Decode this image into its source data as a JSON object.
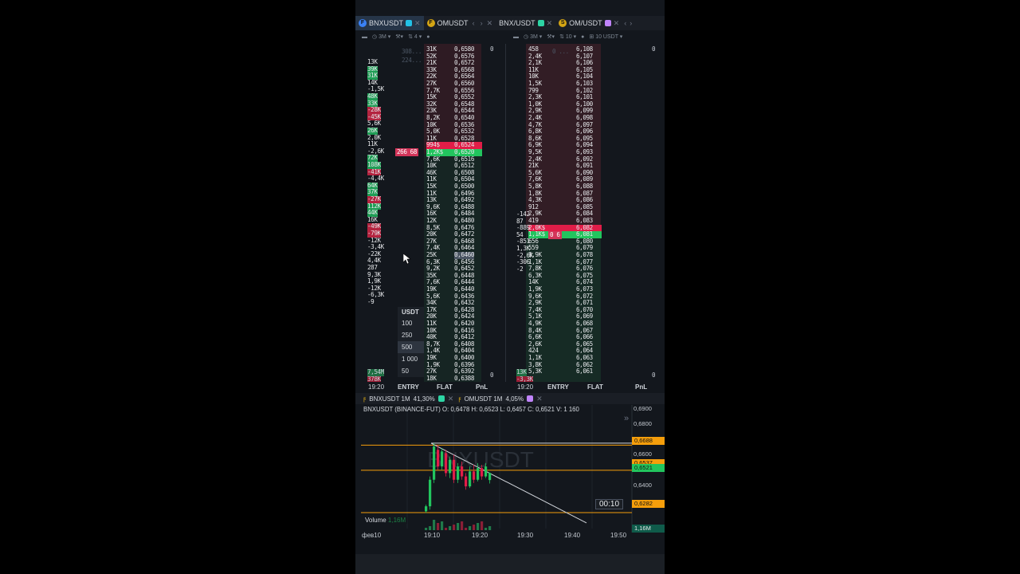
{
  "tabs": [
    {
      "label": "BNXUSDT",
      "badge": "F",
      "color": "#3b82f6",
      "sq": "#22c1e6",
      "active": true
    },
    {
      "label": "OMUSDT",
      "badge": "F",
      "color": "#d4a514",
      "sq": null,
      "active": false
    },
    {
      "label": "BNX/USDT",
      "badge": null,
      "color": null,
      "sq": "#2dd4a4",
      "active": false
    },
    {
      "label": "OM/USDT",
      "badge": "S",
      "color": "#d4a514",
      "sq": "#c084fc",
      "active": false
    }
  ],
  "toolbars": {
    "left": {
      "timeframe": "3M",
      "extra": "4"
    },
    "right": {
      "timeframe": "3M",
      "extra": "10",
      "scale": "10 USDT"
    }
  },
  "left_pane": {
    "top_ghost": [
      "308...",
      "224..."
    ],
    "zero_top": "0",
    "zero_bottom": "0",
    "clusters": [
      "13K",
      "39K",
      "31K",
      "14K",
      "-1,5K",
      "48K",
      "33K",
      "-28K",
      "-45K",
      "5,6K",
      "26K",
      "2,0K",
      "11K",
      "-2,6K",
      "72K",
      "108K",
      "-41K",
      "-4,4K",
      "64K",
      "37K",
      "-27K",
      "112K",
      "44K",
      "16K",
      "-49K",
      "-79K",
      "-12K",
      "-3,4K",
      "-22K",
      "4,4K",
      "287",
      "9,3K",
      "1,9K",
      "-12K",
      "-6,3K",
      "-9"
    ],
    "position_tag": "266 68",
    "volumes": [
      "31K",
      "52K",
      "21K",
      "33K",
      "22K",
      "27K",
      "7,7K",
      "15K",
      "32K",
      "23K",
      "8,2K",
      "10K",
      "5,0K",
      "11K",
      "994$",
      "1,2K$",
      "7,6K",
      "10K",
      "46K",
      "11K",
      "15K",
      "11K",
      "13K",
      "9,6K",
      "16K",
      "12K",
      "8,5K",
      "20K",
      "27K",
      "7,4K",
      "25K",
      "6,3K",
      "9,2K",
      "35K",
      "7,6K",
      "19K",
      "5,6K",
      "34K",
      "17K",
      "20K",
      "11K",
      "10K",
      "40K",
      "8,7K",
      "1,4K",
      "19K",
      "1,9K",
      "27K",
      "18K"
    ],
    "prices": [
      "0,6580",
      "0,6576",
      "0,6572",
      "0,6568",
      "0,6564",
      "0,6560",
      "0,6556",
      "0,6552",
      "0,6548",
      "0,6544",
      "0,6540",
      "0,6536",
      "0,6532",
      "0,6528",
      "0,6524",
      "0,6520",
      "0,6516",
      "0,6512",
      "0,6508",
      "0,6504",
      "0,6500",
      "0,6496",
      "0,6492",
      "0,6488",
      "0,6484",
      "0,6480",
      "0,6476",
      "0,6472",
      "0,6468",
      "0,6464",
      "0,6460",
      "0,6456",
      "0,6452",
      "0,6448",
      "0,6444",
      "0,6440",
      "0,6436",
      "0,6432",
      "0,6428",
      "0,6424",
      "0,6420",
      "0,6416",
      "0,6412",
      "0,6408",
      "0,6404",
      "0,6400",
      "0,6396",
      "0,6392",
      "0,6388"
    ],
    "bottom_clusters": [
      "7,54M",
      "378K"
    ],
    "time": "19:20",
    "footer": [
      "ENTRY",
      "FLAT",
      "PnL"
    ]
  },
  "right_pane": {
    "top_ghost": "0 ...",
    "zero_top": "0",
    "zero_bottom": "0",
    "clusters": [
      "-142",
      "87",
      "-889",
      "54",
      "-851",
      "1,3K",
      "-2,6K",
      "-306",
      "-2"
    ],
    "position_tag": "0 6",
    "volumes": [
      "458",
      "2,4K",
      "2,1K",
      "11K",
      "10K",
      "1,5K",
      "799",
      "2,3K",
      "1,0K",
      "2,9K",
      "2,4K",
      "4,7K",
      "6,8K",
      "8,6K",
      "6,9K",
      "9,5K",
      "2,4K",
      "21K",
      "5,6K",
      "7,6K",
      "5,8K",
      "1,8K",
      "4,3K",
      "912",
      "2,9K",
      "419",
      "2,0K$",
      "1,1K$",
      "656",
      "559",
      "8,9K",
      "1,1K",
      "7,8K",
      "6,3K",
      "14K",
      "1,9K",
      "9,6K",
      "2,9K",
      "7,4K",
      "5,1K",
      "4,9K",
      "8,4K",
      "6,6K",
      "2,6K",
      "424",
      "1,1K",
      "3,8K",
      "5,3K"
    ],
    "prices": [
      "6,108",
      "6,107",
      "6,106",
      "6,105",
      "6,104",
      "6,103",
      "6,102",
      "6,101",
      "6,100",
      "6,099",
      "6,098",
      "6,097",
      "6,096",
      "6,095",
      "6,094",
      "6,093",
      "6,092",
      "6,091",
      "6,090",
      "6,089",
      "6,088",
      "6,087",
      "6,086",
      "6,085",
      "6,084",
      "6,083",
      "6,082",
      "6,081",
      "6,080",
      "6,079",
      "6,078",
      "6,077",
      "6,076",
      "6,075",
      "6,074",
      "6,073",
      "6,072",
      "6,071",
      "6,070",
      "6,069",
      "6,068",
      "6,067",
      "6,066",
      "6,065",
      "6,064",
      "6,063",
      "6,062",
      "6,061",
      "6,060"
    ],
    "bottom_clusters": [
      "13K",
      "-3,3K"
    ],
    "time": "19:20",
    "footer": [
      "ENTRY",
      "FLAT",
      "PnL"
    ]
  },
  "order_size": {
    "header": "USDT",
    "options": [
      "100",
      "250",
      "500",
      "1 000",
      "50"
    ],
    "selected": "500"
  },
  "chart_tabs": [
    {
      "label": "BNXUSDT 1M",
      "change": "41,30%",
      "sq": "#2dd4a4"
    },
    {
      "label": "OMUSDT 1M",
      "change": "4,05%",
      "sq": "#c084fc"
    }
  ],
  "chart": {
    "info": "BNXUSDT (BINANCE-FUT)  O: 0,6478  H: 0,6523  L: 0,6457  C: 0,6521  V: 1 160",
    "watermark": "BNXUSDT",
    "volume_label": "Volume",
    "volume_value": "1,16M",
    "volume_right": "1,16M",
    "timer": "00:10",
    "price_axis": [
      "0,6900",
      "0,6800",
      "0,6600",
      "0,6400"
    ],
    "tags": [
      {
        "text": "0,6688",
        "color": "#f59e0b"
      },
      {
        "text": "0,6537",
        "color": "#f59e0b"
      },
      {
        "text": "0,6521",
        "color": "#22c55e"
      },
      {
        "text": "0,6282",
        "color": "#f59e0b"
      }
    ],
    "x_labels": [
      "фев10",
      "19:10",
      "19:20",
      "19:30",
      "19:40",
      "19:50"
    ],
    "candles": [
      {
        "o": 0.629,
        "c": 0.632,
        "h": 0.633,
        "l": 0.628
      },
      {
        "o": 0.632,
        "c": 0.648,
        "h": 0.65,
        "l": 0.63
      },
      {
        "o": 0.648,
        "c": 0.668,
        "h": 0.67,
        "l": 0.646
      },
      {
        "o": 0.666,
        "c": 0.656,
        "h": 0.669,
        "l": 0.654
      },
      {
        "o": 0.656,
        "c": 0.665,
        "h": 0.667,
        "l": 0.654
      },
      {
        "o": 0.664,
        "c": 0.652,
        "h": 0.666,
        "l": 0.65
      },
      {
        "o": 0.652,
        "c": 0.66,
        "h": 0.662,
        "l": 0.649
      },
      {
        "o": 0.66,
        "c": 0.648,
        "h": 0.663,
        "l": 0.646
      },
      {
        "o": 0.648,
        "c": 0.656,
        "h": 0.658,
        "l": 0.646
      },
      {
        "o": 0.656,
        "c": 0.65,
        "h": 0.659,
        "l": 0.648
      },
      {
        "o": 0.65,
        "c": 0.644,
        "h": 0.652,
        "l": 0.642
      },
      {
        "o": 0.644,
        "c": 0.653,
        "h": 0.656,
        "l": 0.643
      },
      {
        "o": 0.653,
        "c": 0.648,
        "h": 0.657,
        "l": 0.646
      },
      {
        "o": 0.648,
        "c": 0.655,
        "h": 0.658,
        "l": 0.647
      },
      {
        "o": 0.655,
        "c": 0.65,
        "h": 0.657,
        "l": 0.648
      },
      {
        "o": 0.65,
        "c": 0.656,
        "h": 0.658,
        "l": 0.649
      },
      {
        "o": 0.6478,
        "c": 0.6521,
        "h": 0.6523,
        "l": 0.6457
      }
    ],
    "levels": [
      0.6688,
      0.6537,
      0.6282
    ]
  }
}
